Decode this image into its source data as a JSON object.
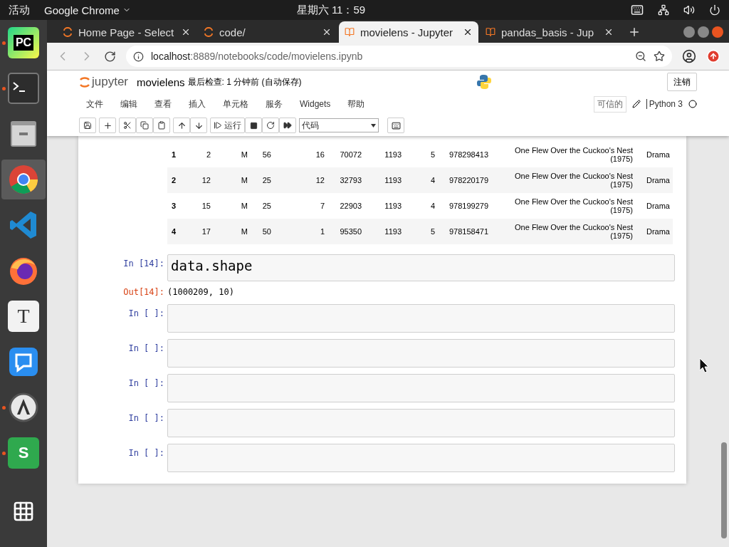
{
  "top_bar": {
    "activities": "活动",
    "app": "Google Chrome",
    "clock": "星期六 11：59"
  },
  "dock": [
    {
      "kind": "pycharm",
      "label": "PC",
      "selected": false,
      "running": true
    },
    {
      "kind": "terminal",
      "selected": false,
      "running": true
    },
    {
      "kind": "files",
      "selected": false,
      "running": false
    },
    {
      "kind": "chrome",
      "selected": true,
      "running": false
    },
    {
      "kind": "vscode",
      "selected": false,
      "running": false
    },
    {
      "kind": "firefox",
      "selected": false,
      "running": false
    },
    {
      "kind": "typora",
      "label": "T",
      "selected": false,
      "running": false
    },
    {
      "kind": "chat",
      "selected": false,
      "running": false
    },
    {
      "kind": "updater",
      "selected": false,
      "running": true
    },
    {
      "kind": "sheets",
      "label": "S",
      "selected": false,
      "running": true
    }
  ],
  "tabs": [
    {
      "title": "Home Page - Select",
      "kind": "jupyter",
      "selected": false
    },
    {
      "title": "code/",
      "kind": "jupyter",
      "selected": false
    },
    {
      "title": "movielens - Jupyter",
      "kind": "notebook",
      "selected": true
    },
    {
      "title": "pandas_basis - Jup",
      "kind": "notebook",
      "selected": false
    }
  ],
  "address": {
    "host": "localhost",
    "path": ":8889/notebooks/code/movielens.ipynb"
  },
  "jupyter": {
    "logo": "jupyter",
    "name": "movielens",
    "checkpoint": "最后检查: 1 分钟前  (自动保存)",
    "logout": "注销",
    "menu": [
      "文件",
      "编辑",
      "查看",
      "插入",
      "单元格",
      "服务",
      "Widgets",
      "帮助"
    ],
    "trusted": "可信的",
    "kernel": "Python 3",
    "run": "运行",
    "cell_type": "代码"
  },
  "table": {
    "rows": [
      {
        "index": "1",
        "cells": [
          "2",
          "M",
          "56",
          "16",
          "70072",
          "1193",
          "5",
          "978298413",
          "One Flew Over the Cuckoo's Nest (1975)",
          "Drama"
        ]
      },
      {
        "index": "2",
        "cells": [
          "12",
          "M",
          "25",
          "12",
          "32793",
          "1193",
          "4",
          "978220179",
          "One Flew Over the Cuckoo's Nest (1975)",
          "Drama"
        ]
      },
      {
        "index": "3",
        "cells": [
          "15",
          "M",
          "25",
          "7",
          "22903",
          "1193",
          "4",
          "978199279",
          "One Flew Over the Cuckoo's Nest (1975)",
          "Drama"
        ]
      },
      {
        "index": "4",
        "cells": [
          "17",
          "M",
          "50",
          "1",
          "95350",
          "1193",
          "5",
          "978158471",
          "One Flew Over the Cuckoo's Nest (1975)",
          "Drama"
        ]
      }
    ]
  },
  "cells": [
    {
      "prompt": "In [14]:",
      "code": "data.shape",
      "out_prompt": "Out[14]:",
      "output": "(1000209, 10)"
    },
    {
      "prompt": "In [ ]:"
    },
    {
      "prompt": "In [ ]:"
    },
    {
      "prompt": "In [ ]:"
    },
    {
      "prompt": "In [ ]:"
    },
    {
      "prompt": "In [ ]:"
    }
  ]
}
